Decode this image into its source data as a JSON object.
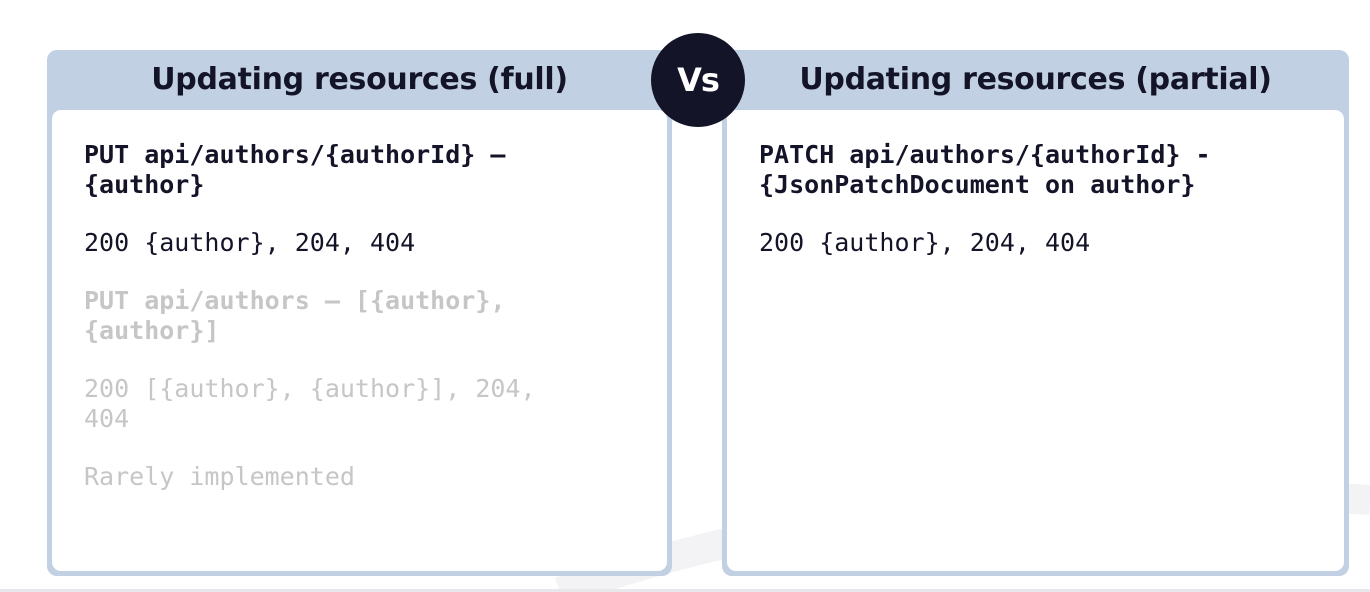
{
  "left_panel": {
    "title": "Updating resources (full)",
    "items": [
      {
        "text": "PUT api/authors/{authorId} –\n{author}"
      },
      {
        "text": "200 {author}, 204, 404"
      },
      {
        "text": "PUT api/authors – [{author},\n{author}]"
      },
      {
        "text": "200 [{author}, {author}], 204,\n404"
      },
      {
        "text": "Rarely implemented"
      }
    ]
  },
  "vs_label": "Vs",
  "right_panel": {
    "title": "Updating resources (partial)",
    "items": [
      {
        "text": "PATCH api/authors/{authorId} -\n{JsonPatchDocument on author}"
      },
      {
        "text": "200 {author}, 204, 404"
      }
    ]
  }
}
